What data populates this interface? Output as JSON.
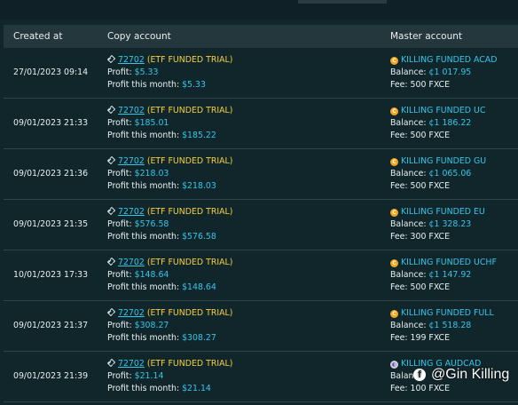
{
  "header": {
    "created_at": "Created at",
    "copy_account": "Copy account",
    "master_account": "Master account"
  },
  "rows": [
    {
      "created": "27/01/2023 09:14",
      "account_id": "72702",
      "account_type": "(ETF FUNDED TRIAL)",
      "profit_label": "Profit:",
      "profit": "$5.33",
      "profit_month_label": "Profit this month:",
      "profit_month": "$5.33",
      "master_name": "KILLING FUNDED ACAD",
      "balance_label": "Balance:",
      "balance": "¢1 017.95",
      "fee": "Fee: 500 FXCE"
    },
    {
      "created": "09/01/2023 21:33",
      "account_id": "72702",
      "account_type": "(ETF FUNDED TRIAL)",
      "profit_label": "Profit:",
      "profit": "$185.01",
      "profit_month_label": "Profit this month:",
      "profit_month": "$185.22",
      "master_name": "KILLING FUNDED UC",
      "balance_label": "Balance:",
      "balance": "¢1 186.22",
      "fee": "Fee: 500 FXCE"
    },
    {
      "created": "09/01/2023 21:36",
      "account_id": "72702",
      "account_type": "(ETF FUNDED TRIAL)",
      "profit_label": "Profit:",
      "profit": "$218.03",
      "profit_month_label": "Profit this month:",
      "profit_month": "$218.03",
      "master_name": "KILLING FUNDED GU",
      "balance_label": "Balance:",
      "balance": "¢1 065.06",
      "fee": "Fee: 500 FXCE"
    },
    {
      "created": "09/01/2023 21:35",
      "account_id": "72702",
      "account_type": "(ETF FUNDED TRIAL)",
      "profit_label": "Profit:",
      "profit": "$576.58",
      "profit_month_label": "Profit this month:",
      "profit_month": "$576.58",
      "master_name": "KILLING FUNDED EU",
      "balance_label": "Balance:",
      "balance": "¢1 328.23",
      "fee": "Fee: 300 FXCE"
    },
    {
      "created": "10/01/2023 17:33",
      "account_id": "72702",
      "account_type": "(ETF FUNDED TRIAL)",
      "profit_label": "Profit:",
      "profit": "$148.64",
      "profit_month_label": "Profit this month:",
      "profit_month": "$148.64",
      "master_name": "KILLING FUNDED UCHF",
      "balance_label": "Balance:",
      "balance": "¢1 147.92",
      "fee": "Fee: 500 FXCE"
    },
    {
      "created": "09/01/2023 21:37",
      "account_id": "72702",
      "account_type": "(ETF FUNDED TRIAL)",
      "profit_label": "Profit:",
      "profit": "$308.27",
      "profit_month_label": "Profit this month:",
      "profit_month": "$308.27",
      "master_name": "KILLING FUNDED FULL",
      "balance_label": "Balance:",
      "balance": "¢1 518.28",
      "fee": "Fee: 199 FXCE"
    },
    {
      "created": "09/01/2023 21:39",
      "account_id": "72702",
      "account_type": "(ETF FUNDED TRIAL)",
      "profit_label": "Profit:",
      "profit": "$21.14",
      "profit_month_label": "Profit this month:",
      "profit_month": "$21.14",
      "master_name": "KILLING G AUDCAD",
      "balance_label": "Balan",
      "balance": "",
      "fee": "Fee: 100 FXCE"
    }
  ],
  "watermark": {
    "logo": "f",
    "text": "@Gin Killing"
  },
  "colors": {
    "background": "#11262b",
    "header_bg": "#23373c",
    "link": "#34c6ea",
    "etf": "#f5cf3f",
    "coin": "#f3a51b"
  },
  "icons": {
    "copy_account": "link-copy-icon",
    "master_account": "coin-icon"
  }
}
